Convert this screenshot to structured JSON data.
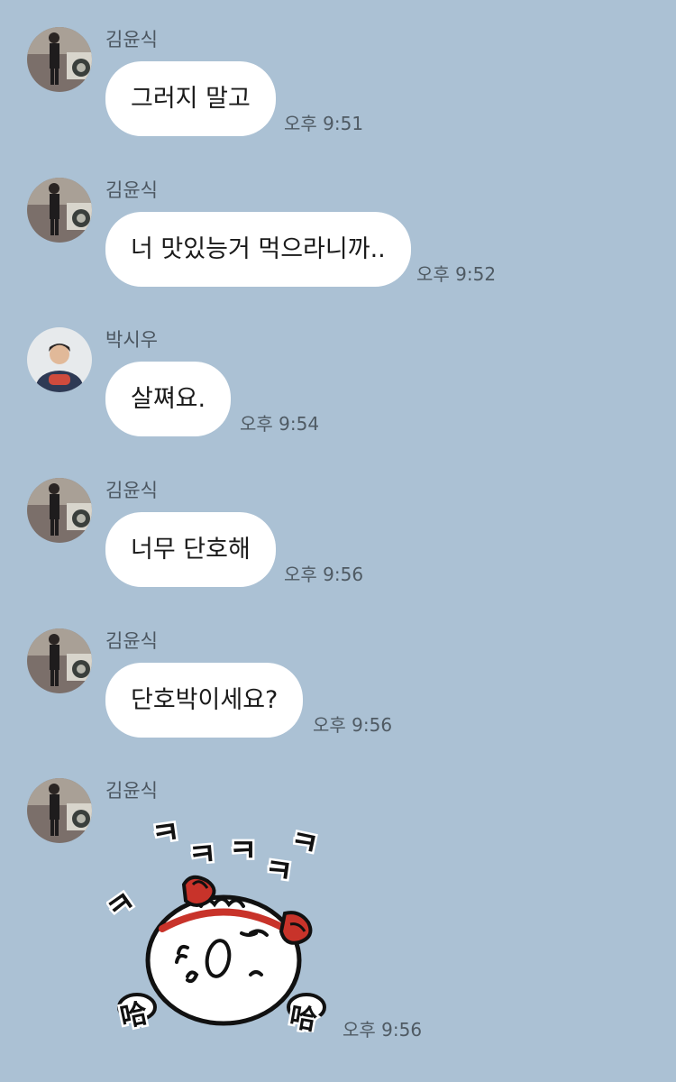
{
  "messages": [
    {
      "sender": "김윤식",
      "text": "그러지 말고",
      "time": "오후 9:51",
      "avatar_icon": "person-photo-icon"
    },
    {
      "sender": "김윤식",
      "text": "너 맛있능거 먹으라니까..",
      "time": "오후 9:52",
      "avatar_icon": "person-photo-icon"
    },
    {
      "sender": "박시우",
      "text": "살쪄요.",
      "time": "오후 9:54",
      "avatar_icon": "person-photo-icon"
    },
    {
      "sender": "김윤식",
      "text": "너무 단호해",
      "time": "오후 9:56",
      "avatar_icon": "person-photo-icon"
    },
    {
      "sender": "김윤식",
      "text": "단호박이세요?",
      "time": "오후 9:56",
      "avatar_icon": "person-photo-icon"
    },
    {
      "sender": "김윤식",
      "sticker": {
        "icon": "laughing-dumpling-sticker-icon",
        "text_marks": [
          "ㅋ",
          "ㅋ",
          "ㅋ",
          "ㅋ",
          "ㅋ",
          "ㅋ",
          "哈",
          "哈"
        ]
      },
      "time": "오후 9:56",
      "avatar_icon": "person-photo-icon"
    }
  ],
  "colors": {
    "background": "#abc1d4",
    "bubble": "#ffffff",
    "sender_text": "#4b5660",
    "time_text": "#4f5a63",
    "message_text": "#1a1a1a"
  }
}
